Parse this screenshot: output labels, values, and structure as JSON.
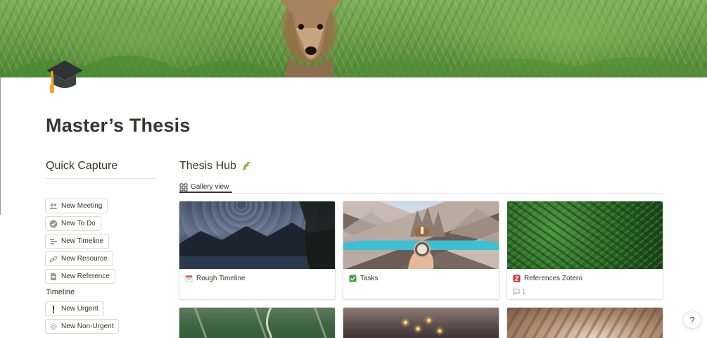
{
  "page": {
    "title": "Master’s Thesis",
    "icon": "graduation-cap-icon"
  },
  "quick_capture": {
    "heading": "Quick Capture",
    "buttons": [
      {
        "label": "New Meeting",
        "icon": "people-icon"
      },
      {
        "label": "New To Do",
        "icon": "check-circle-icon"
      },
      {
        "label": "New Timeline",
        "icon": "timeline-icon"
      },
      {
        "label": "New Resource",
        "icon": "link-icon"
      },
      {
        "label": "New Reference",
        "icon": "document-icon"
      }
    ],
    "timeline_heading": "Timeline",
    "timeline_buttons": [
      {
        "label": "New Urgent",
        "icon": "exclamation-icon"
      },
      {
        "label": "New Non-Urgent",
        "icon": "sun-icon"
      }
    ]
  },
  "hub": {
    "heading": "Thesis Hub",
    "heading_icon": "herb-icon",
    "view_tab": "Gallery view",
    "cards": [
      {
        "title": "Rough Timeline",
        "icon": "calendar-icon"
      },
      {
        "title": "Tasks",
        "icon": "checkbox-icon"
      },
      {
        "title": "References Zotero",
        "icon": "zotero-icon",
        "comments": "1"
      }
    ]
  },
  "help_label": "?",
  "colors": {
    "text": "#37352f",
    "muted": "#9b9a97",
    "border": "#e0dfdc",
    "check_green": "#45a04a",
    "zotero_red": "#cc2936"
  }
}
